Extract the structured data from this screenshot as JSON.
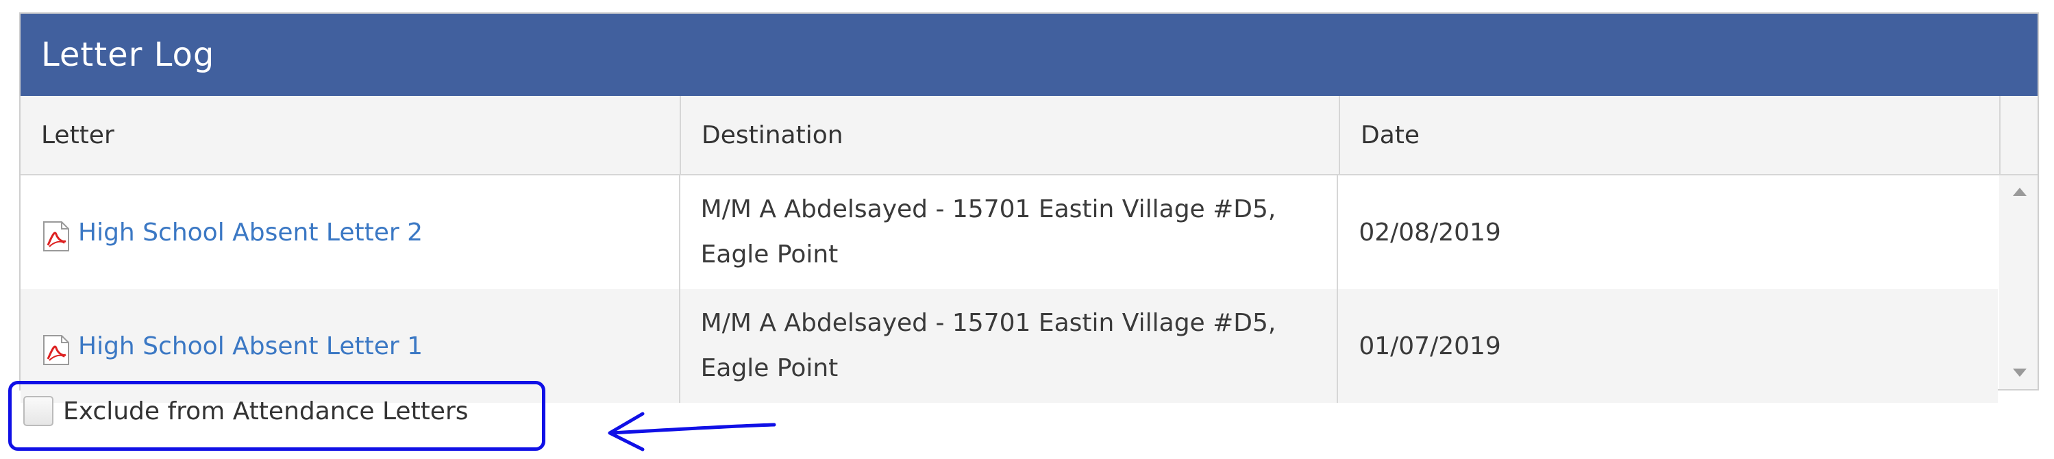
{
  "panel": {
    "title": "Letter Log"
  },
  "table": {
    "columns": [
      "Letter",
      "Destination",
      "Date"
    ],
    "rows": [
      {
        "letter": "High School Absent Letter 2",
        "destination": "M/M A Abdelsayed - 15701 Eastin Village #D5, Eagle Point",
        "date": "02/08/2019"
      },
      {
        "letter": "High School Absent Letter 1",
        "destination": "M/M A Abdelsayed - 15701 Eastin Village #D5, Eagle Point",
        "date": "01/07/2019"
      }
    ]
  },
  "exclude_checkbox": {
    "label": "Exclude from Attendance Letters",
    "checked": false
  },
  "icons": {
    "file": "pdf-icon",
    "annotation": "left-arrow-icon"
  },
  "colors": {
    "header": "#41609e",
    "link": "#3b78c4",
    "annotation": "#1010e6"
  }
}
